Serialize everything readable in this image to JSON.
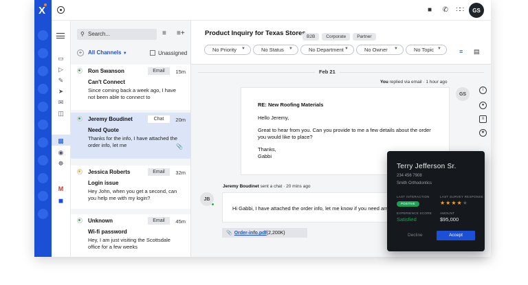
{
  "brand": {
    "logo_glyph": "X",
    "accent": "#1b4fd6",
    "dot_color": "#f58220"
  },
  "topbar": {
    "user_initials": "GS",
    "icons": [
      "home-icon",
      "chat-icon",
      "phone-icon",
      "apps-grid-icon"
    ]
  },
  "list": {
    "search_placeholder": "Search...",
    "channels_label": "All Channels",
    "unassigned_label": "Unassigned",
    "conversations": [
      {
        "name": "Ron Swanson",
        "channel": "Email",
        "time": "15m",
        "subject": "Can't Connect",
        "preview": "Since coming back a week ago, I have not been able to connect to",
        "status_color": "#34a853"
      },
      {
        "name": "Jeremy Boudinet",
        "channel": "Chat",
        "time": "20m",
        "subject": "Need Quote",
        "preview": "Thanks for the info, I have attached the order info, let me",
        "status_color": "#34a853"
      },
      {
        "name": "Jessica Roberts",
        "channel": "Email",
        "time": "32m",
        "subject": "Login issue",
        "preview": "Hey John, when you get a second, can you help me with my login?",
        "status_color": "#f5a623"
      },
      {
        "name": "Unknown",
        "channel": "Email",
        "time": "45m",
        "subject": "Wi-fi password",
        "preview": "Hey, I am just visiting the Scottsdale office for a few weeks",
        "status_color": "#34a853"
      }
    ]
  },
  "main": {
    "title": "Product Inquiry for Texas Stores",
    "tags": [
      "B2B",
      "Corporate",
      "Partner"
    ],
    "filters": [
      "No Priority",
      "No Status",
      "No Department",
      "No Owner",
      "No Topic"
    ],
    "date": "Feb 21",
    "reply_meta": {
      "who": "You",
      "action": " replied via email",
      "time": "1 hour ago"
    },
    "email": {
      "subject": "RE: New Roofing Materials",
      "greeting": "Hello Jeremy,",
      "body": "Great to hear from you. Can you provide to me a few details about the order you would like to place?",
      "closing": "Thanks,",
      "signature": "Gabbi"
    },
    "agent_initials": "GS",
    "chat_meta": {
      "who": "Jeremy Boudinet",
      "action": " sent a chat",
      "time": "20 mins ago"
    },
    "customer_initials": "JB",
    "chat_message": "Hi Gabbi, I have attached the order info, let me know if you need anything else",
    "attachment": {
      "filename": "Order-info.pdf",
      "size": "(2,200K)"
    }
  },
  "popup": {
    "name": "Terry Jefferson Sr.",
    "phone": "234 456 7908",
    "company": "Smith Orthodontics",
    "last_interaction_label": "LAST INTERACTION",
    "last_interaction_value": "POSITIVE",
    "last_survey_label": "LAST SURVEY RESPONSE",
    "survey_stars": 4,
    "survey_max": 5,
    "experience_label": "EXPERIENCE SCORE",
    "experience_value": "Satisfied",
    "amount_label": "AMOUNT",
    "amount_value": "$95,000",
    "decline_label": "Decline",
    "accept_label": "Accept"
  }
}
